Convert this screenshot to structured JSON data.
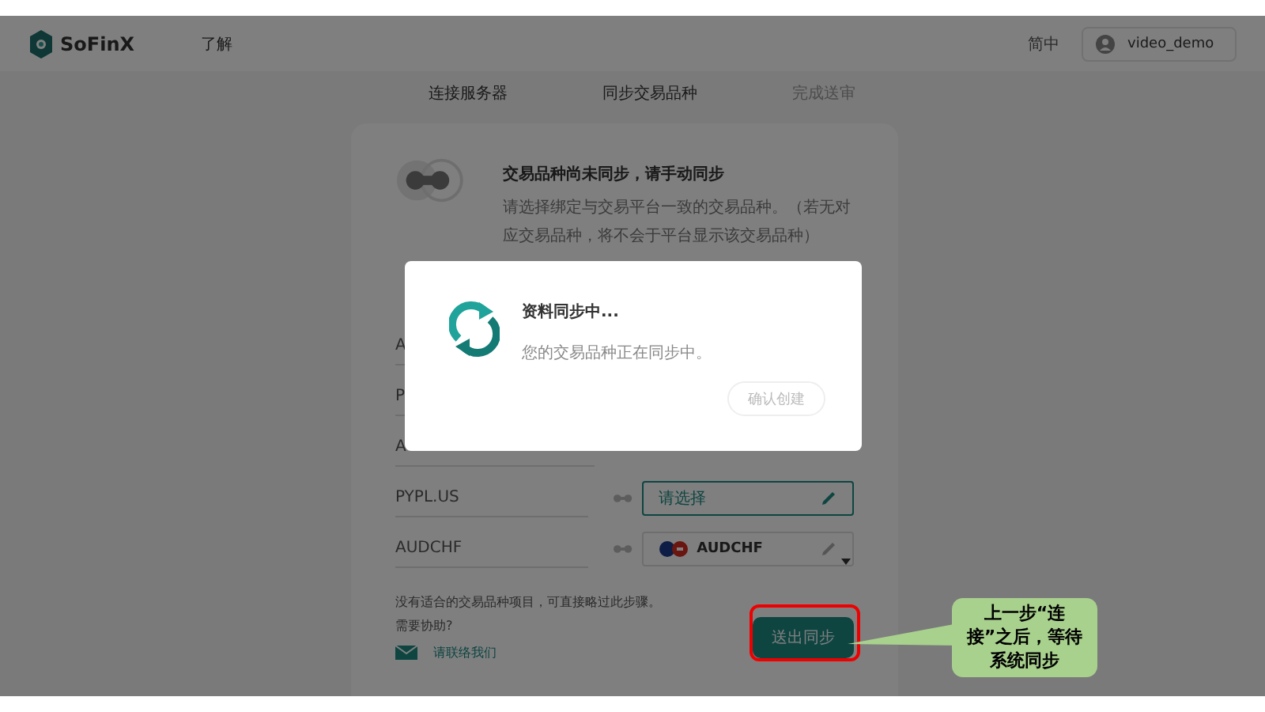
{
  "header": {
    "brand": "SoFinX",
    "nav": "了解",
    "language": "简中",
    "user": "video_demo"
  },
  "steps": [
    {
      "label": "连接服务器",
      "done": true
    },
    {
      "label": "同步交易品种",
      "done": true
    },
    {
      "label": "完成送审",
      "done": false
    }
  ],
  "card": {
    "title": "交易品种尚未同步，请手动同步",
    "description": "请选择绑定与交易平台一致的交易品种。（若无对应交易品种，将不会于平台显示该交易品种）",
    "rows": [
      {
        "kind": "hidden",
        "symbol": "A"
      },
      {
        "kind": "hidden",
        "symbol": "P"
      },
      {
        "kind": "hidden",
        "symbol": "A"
      },
      {
        "kind": "select",
        "symbol": "PYPL.US",
        "value": "请选择",
        "focused": true
      },
      {
        "kind": "symbol",
        "symbol": "AUDCHF",
        "value": "AUDCHF",
        "focused": false
      }
    ],
    "note": "没有适合的交易品种项目，可直接略过此步骤。",
    "help": "需要协助?",
    "contact": "请联络我们",
    "submit": "送出同步"
  },
  "modal": {
    "title": "资料同步中...",
    "message": "您的交易品种正在同步中。",
    "button": {
      "label": "确认创建",
      "disabled": true
    }
  },
  "callout": {
    "text": "上一步“连接”之后，等待系统同步"
  }
}
